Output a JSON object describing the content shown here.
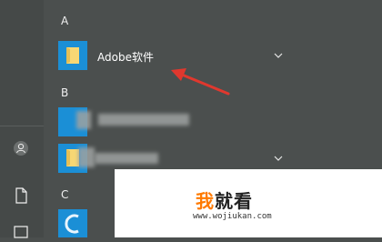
{
  "app_list": {
    "groups": [
      {
        "letter": "A",
        "items": [
          {
            "label": "Adobe软件"
          }
        ]
      },
      {
        "letter": "B"
      },
      {
        "letter": "C"
      }
    ]
  },
  "watermark": {
    "brand_first": "我",
    "brand_rest": "就看",
    "url": "www.wojiukan.com"
  },
  "colors": {
    "background": "#4b4f4e",
    "tile_blue": "#1b8fd6",
    "folder_yellow": "#f7d774",
    "arrow_red": "#e0382e",
    "brand_orange": "#ff7a00"
  },
  "icons": {
    "user": "user-icon",
    "document": "document-icon",
    "folder": "folder-icon",
    "chevron": "chevron-down-icon",
    "arrow": "annotation-arrow"
  }
}
